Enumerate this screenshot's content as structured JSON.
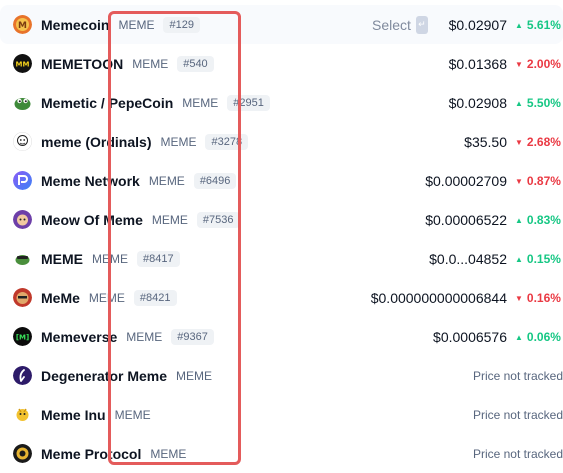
{
  "select_label": "Select",
  "untracked_text": "Price not tracked",
  "colors": {
    "up": "#16c784",
    "down": "#ea3943",
    "highlight": "#e45b5b"
  },
  "rows": [
    {
      "name": "Memecoin",
      "symbol": "MEME",
      "rank": "#129",
      "price": "$0.02907",
      "change": "5.61%",
      "dir": "up",
      "icon": "memecoin-logo-icon"
    },
    {
      "name": "MEMETOON",
      "symbol": "MEME",
      "rank": "#540",
      "price": "$0.01368",
      "change": "2.00%",
      "dir": "down",
      "icon": "memetoon-logo-icon"
    },
    {
      "name": "Memetic / PepeCoin",
      "symbol": "MEME",
      "rank": "#2951",
      "price": "$0.02908",
      "change": "5.50%",
      "dir": "up",
      "icon": "memetic-logo-icon"
    },
    {
      "name": "meme (Ordinals)",
      "symbol": "MEME",
      "rank": "#3278",
      "price": "$35.50",
      "change": "2.68%",
      "dir": "down",
      "icon": "meme-ordinals-logo-icon"
    },
    {
      "name": "Meme Network",
      "symbol": "MEME",
      "rank": "#6496",
      "price": "$0.00002709",
      "change": "0.87%",
      "dir": "down",
      "icon": "meme-network-logo-icon"
    },
    {
      "name": "Meow Of Meme",
      "symbol": "MEME",
      "rank": "#7536",
      "price": "$0.00006522",
      "change": "0.83%",
      "dir": "up",
      "icon": "meow-of-meme-logo-icon"
    },
    {
      "name": "MEME",
      "symbol": "MEME",
      "rank": "#8417",
      "price": "$0.0...04852",
      "change": "0.15%",
      "dir": "up",
      "icon": "meme-logo-icon"
    },
    {
      "name": "MeMe",
      "symbol": "MEME",
      "rank": "#8421",
      "price": "$0.000000000006844",
      "change": "0.16%",
      "dir": "down",
      "icon": "meme-mixed-logo-icon"
    },
    {
      "name": "Memeverse",
      "symbol": "MEME",
      "rank": "#9367",
      "price": "$0.0006576",
      "change": "0.06%",
      "dir": "up",
      "icon": "memeverse-logo-icon"
    },
    {
      "name": "Degenerator Meme",
      "symbol": "MEME",
      "icon": "degenerator-logo-icon"
    },
    {
      "name": "Meme Inu",
      "symbol": "MEME",
      "icon": "meme-inu-logo-icon"
    },
    {
      "name": "Meme Protocol",
      "symbol": "MEME",
      "icon": "meme-protocol-logo-icon"
    }
  ]
}
